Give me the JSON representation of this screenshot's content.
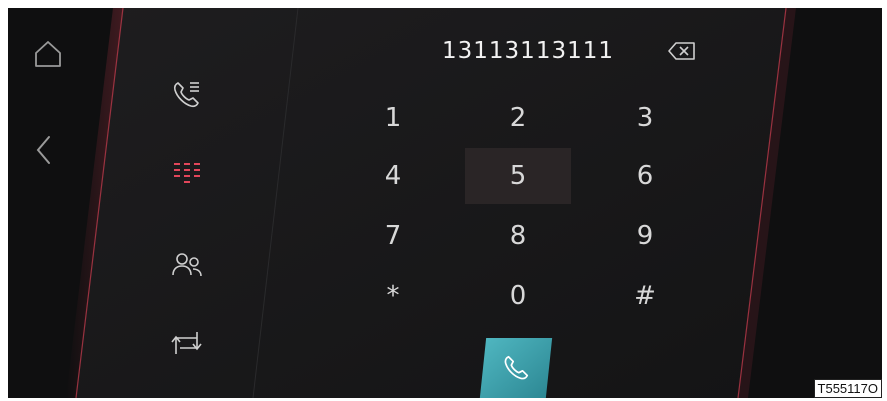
{
  "dialer": {
    "number": "13113113111",
    "keys": [
      {
        "label": "1"
      },
      {
        "label": "2"
      },
      {
        "label": "3"
      },
      {
        "label": "4"
      },
      {
        "label": "5"
      },
      {
        "label": "6"
      },
      {
        "label": "7"
      },
      {
        "label": "8"
      },
      {
        "label": "9"
      },
      {
        "label": "*"
      },
      {
        "label": "0"
      },
      {
        "label": "#"
      }
    ],
    "pressed_key": "5"
  },
  "sidebar": {
    "items": [
      {
        "icon": "call-log-icon"
      },
      {
        "icon": "dialpad-icon",
        "active": true
      },
      {
        "icon": "contacts-icon"
      },
      {
        "icon": "transfer-icon"
      }
    ]
  },
  "nav": {
    "home_icon": "home-icon",
    "back_icon": "back-icon"
  },
  "figure_code": "T555117O",
  "colors": {
    "background": "#0f0f10",
    "accent": "#e2465a",
    "call_button": "#3fa4ae",
    "text": "#d8d8d8"
  }
}
